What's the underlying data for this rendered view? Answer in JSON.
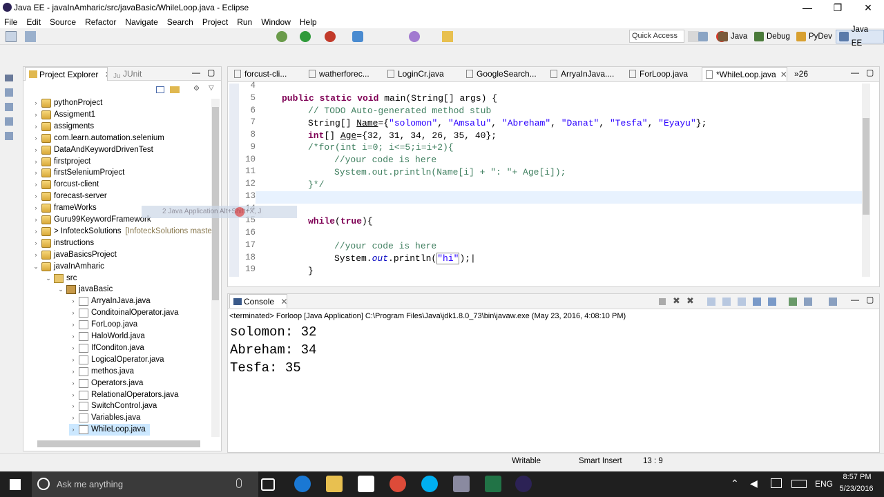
{
  "window": {
    "title": "Java EE - javaInAmharic/src/javaBasic/WhileLoop.java - Eclipse",
    "controls": [
      "—",
      "❐",
      "✕"
    ]
  },
  "menu": [
    "File",
    "Edit",
    "Source",
    "Refactor",
    "Navigate",
    "Search",
    "Project",
    "Run",
    "Window",
    "Help"
  ],
  "toolbar": {
    "quick_access": "Quick Access",
    "perspectives": [
      "Java",
      "Debug",
      "PyDev",
      "Java EE"
    ]
  },
  "explorer": {
    "tabs": [
      "Project Explorer",
      "JUnit"
    ],
    "tree": [
      {
        "label": "pythonProject",
        "type": "proj",
        "level": 0,
        "arrow": "›"
      },
      {
        "label": "Assigment1",
        "type": "proj",
        "level": 0,
        "arrow": "›"
      },
      {
        "label": "assigments",
        "type": "proj",
        "level": 0,
        "arrow": "›"
      },
      {
        "label": "com.learn.automation.selenium",
        "type": "proj",
        "level": 0,
        "arrow": "›"
      },
      {
        "label": "DataAndKeywordDrivenTest",
        "type": "proj",
        "level": 0,
        "arrow": "›"
      },
      {
        "label": "firstproject",
        "type": "proj",
        "level": 0,
        "arrow": "›"
      },
      {
        "label": "firstSeleniumProject",
        "type": "proj",
        "level": 0,
        "arrow": "›"
      },
      {
        "label": "forcust-client",
        "type": "proj",
        "level": 0,
        "arrow": "›"
      },
      {
        "label": "forecast-server",
        "type": "proj",
        "level": 0,
        "arrow": "›"
      },
      {
        "label": "frameWorks",
        "type": "proj",
        "level": 0,
        "arrow": "›"
      },
      {
        "label": "Guru99KeywordFramework",
        "type": "proj",
        "level": 0,
        "arrow": "›"
      },
      {
        "label": "> InfoteckSolutions",
        "type": "proj",
        "level": 0,
        "arrow": "›",
        "deco": "[InfoteckSolutions master]"
      },
      {
        "label": "instructions",
        "type": "proj",
        "level": 0,
        "arrow": "›"
      },
      {
        "label": "javaBasicsProject",
        "type": "proj",
        "level": 0,
        "arrow": "›"
      },
      {
        "label": "javaInAmharic",
        "type": "proj",
        "level": 0,
        "arrow": "⌄"
      },
      {
        "label": "src",
        "type": "src",
        "level": 1,
        "arrow": "⌄"
      },
      {
        "label": "javaBasic",
        "type": "pkg",
        "level": 2,
        "arrow": "⌄"
      },
      {
        "label": "ArryaInJava.java",
        "type": "java",
        "level": 3,
        "arrow": "›"
      },
      {
        "label": "ConditoinalOperator.java",
        "type": "java",
        "level": 3,
        "arrow": "›"
      },
      {
        "label": "ForLoop.java",
        "type": "java",
        "level": 3,
        "arrow": "›"
      },
      {
        "label": "HaloWorld.java",
        "type": "java",
        "level": 3,
        "arrow": "›"
      },
      {
        "label": "IfConditon.java",
        "type": "java",
        "level": 3,
        "arrow": "›"
      },
      {
        "label": "LogicalOperator.java",
        "type": "java",
        "level": 3,
        "arrow": "›"
      },
      {
        "label": "methos.java",
        "type": "java",
        "level": 3,
        "arrow": "›"
      },
      {
        "label": "Operators.java",
        "type": "java",
        "level": 3,
        "arrow": "›"
      },
      {
        "label": "RelationalOperators.java",
        "type": "java",
        "level": 3,
        "arrow": "›"
      },
      {
        "label": "SwitchControl.java",
        "type": "java",
        "level": 3,
        "arrow": "›"
      },
      {
        "label": "Variables.java",
        "type": "java",
        "level": 3,
        "arrow": "›"
      },
      {
        "label": "WhileLoop.java",
        "type": "java",
        "level": 3,
        "arrow": "›",
        "selected": true
      }
    ]
  },
  "editor": {
    "tabs": [
      "forcust-cli...",
      "watherforec...",
      "LoginCr.java",
      "GoogleSearch...",
      "ArryaInJava....",
      "ForLoop.java",
      "*WhileLoop.java",
      "»26"
    ],
    "line_numbers": [
      "4",
      "5",
      "6",
      "7",
      "8",
      "9",
      "10",
      "11",
      "12",
      "13",
      "14",
      "15",
      "16",
      "17",
      "18",
      "19"
    ]
  },
  "popup_hint": "2 Java Application    Alt+Shift+X, J",
  "console": {
    "tab": "Console",
    "terminated": "<terminated> Forloop [Java Application] C:\\Program Files\\Java\\jdk1.8.0_73\\bin\\javaw.exe (May 23, 2016, 4:08:10 PM)",
    "output": [
      "solomon: 32",
      "Abreham: 34",
      "Tesfa: 35"
    ]
  },
  "status": {
    "writable": "Writable",
    "insert_mode": "Smart Insert",
    "position": "13 : 9"
  },
  "taskbar": {
    "search_placeholder": "Ask me anything",
    "lang": "ENG",
    "time": "8:57 PM",
    "date": "5/23/2016"
  }
}
